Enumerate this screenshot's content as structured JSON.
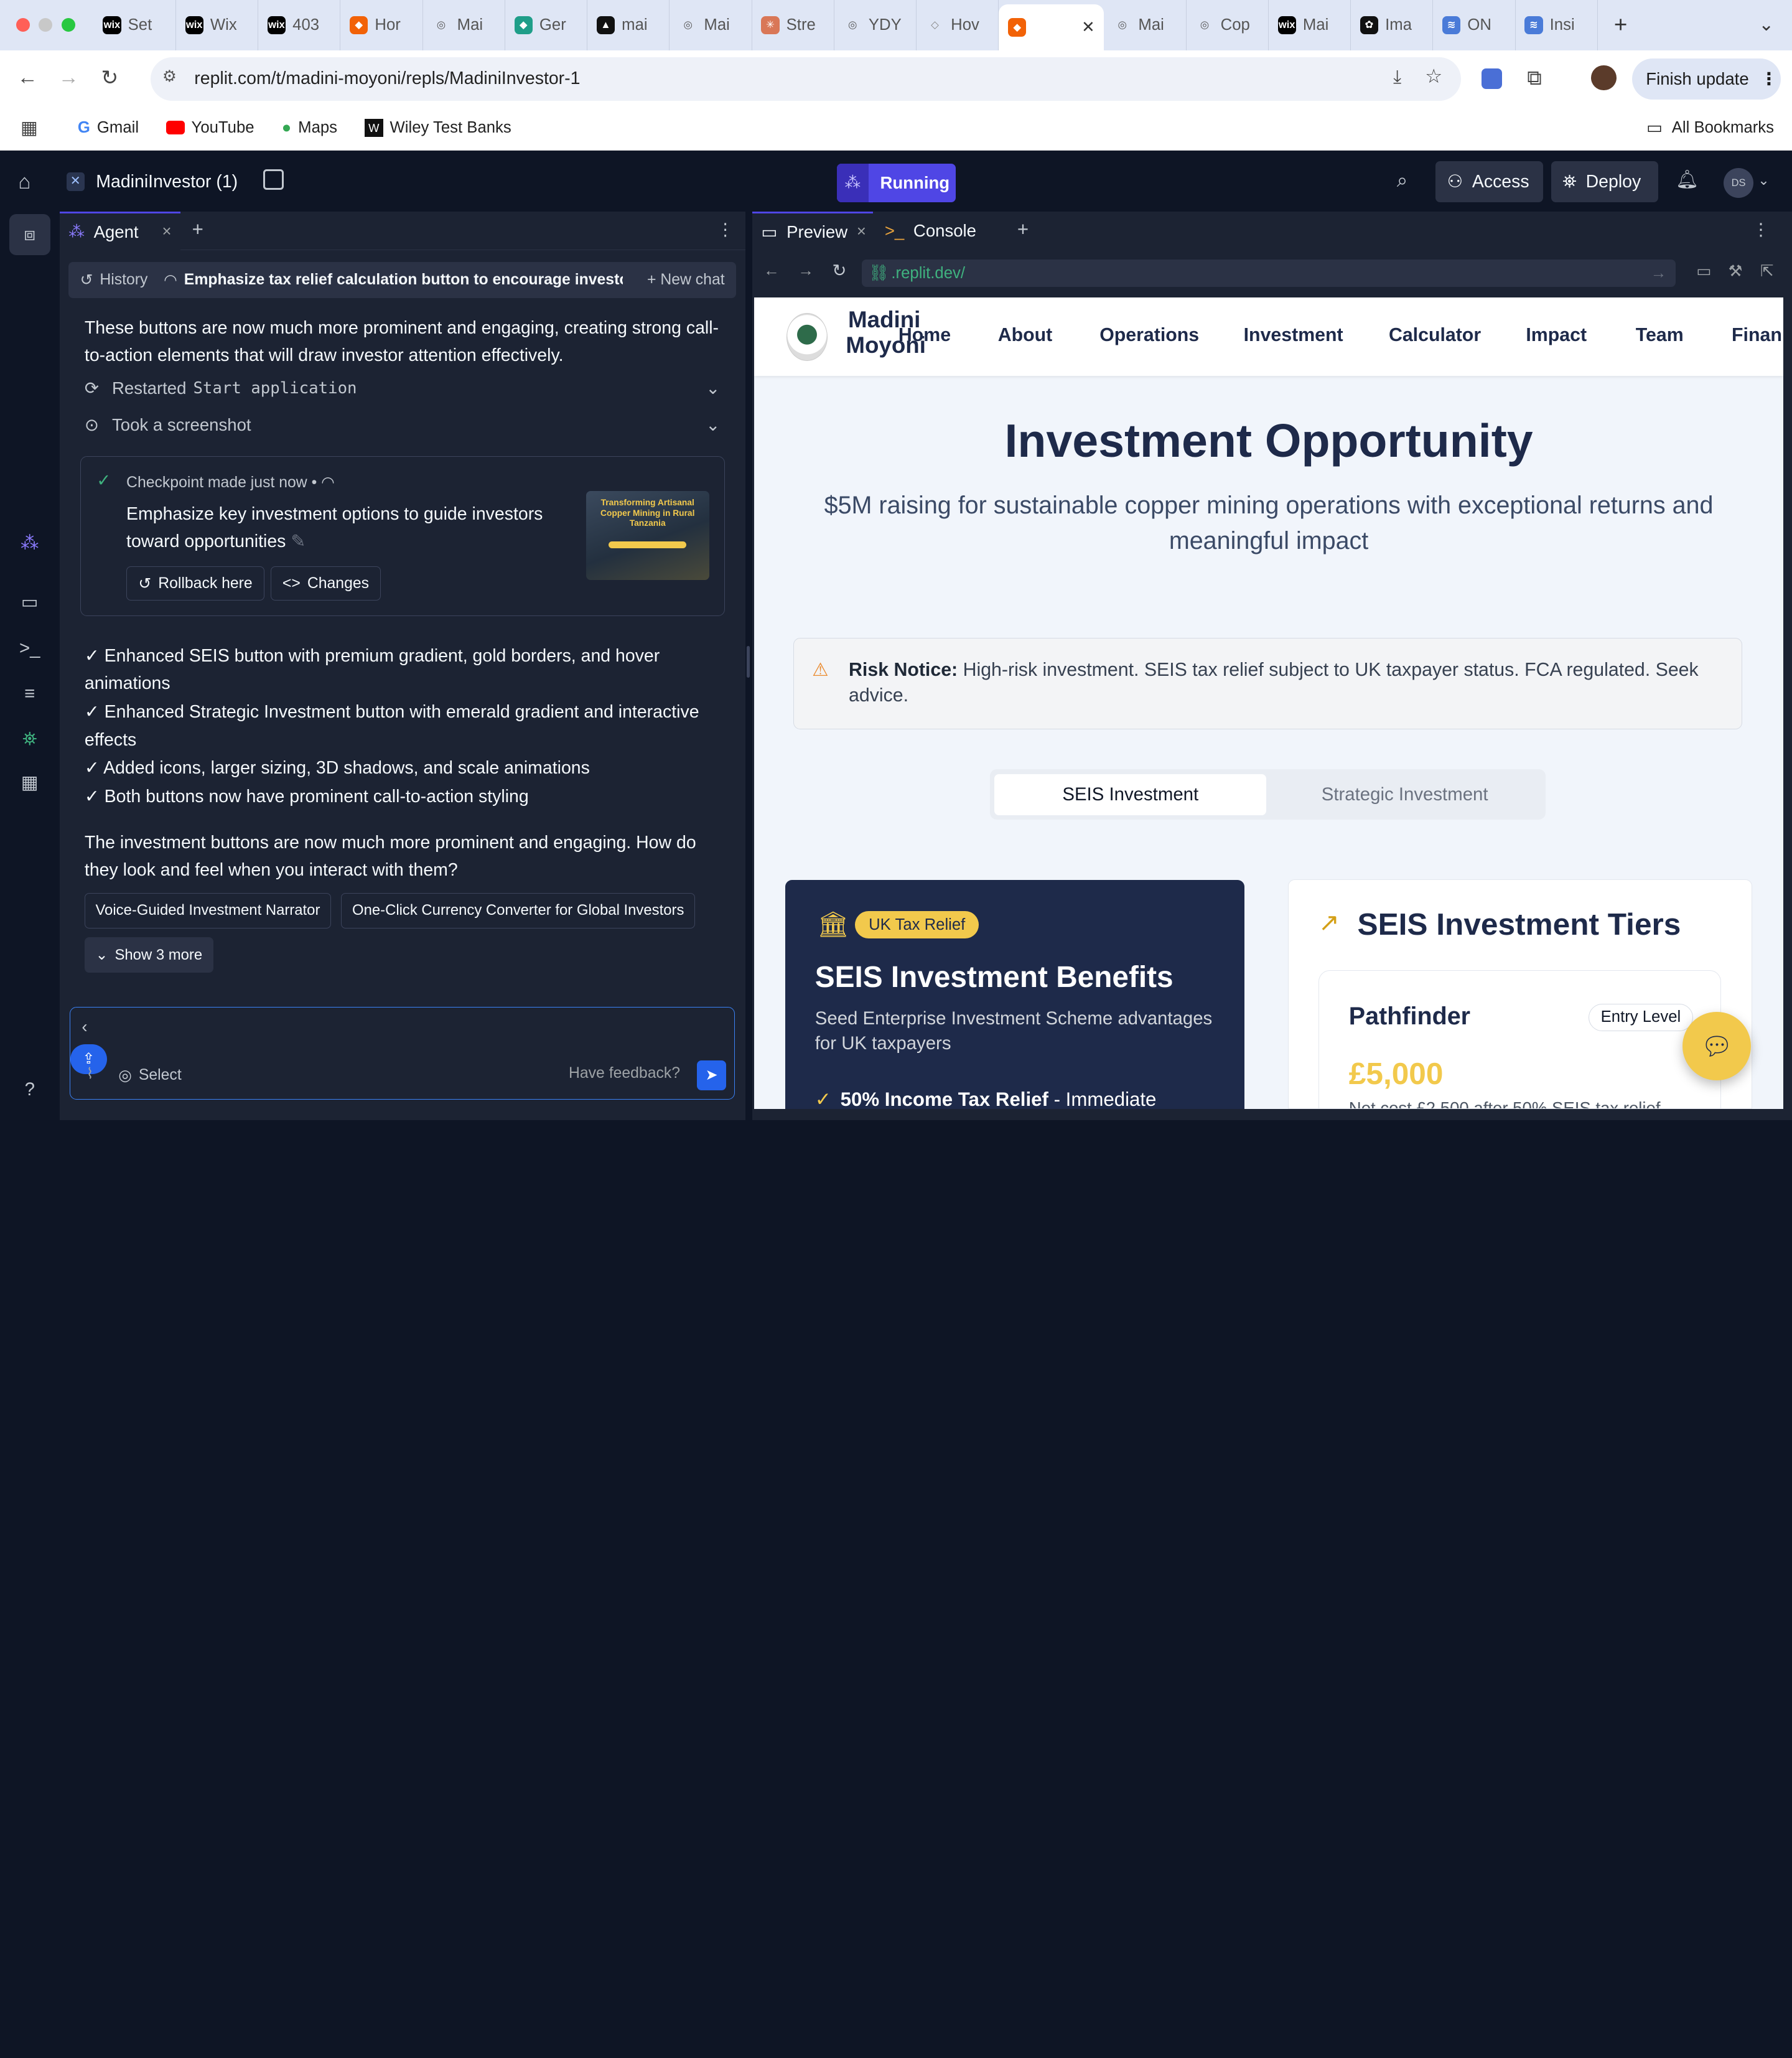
{
  "browser": {
    "tabs": [
      {
        "label": "Set",
        "fav": "wix"
      },
      {
        "label": "Wix",
        "fav": "wix"
      },
      {
        "label": "403",
        "fav": "wix"
      },
      {
        "label": "Hor",
        "fav": "replit"
      },
      {
        "label": "Mai",
        "fav": "globe"
      },
      {
        "label": "Ger",
        "fav": "gem"
      },
      {
        "label": "mai",
        "fav": "tri"
      },
      {
        "label": "Mai",
        "fav": "globe"
      },
      {
        "label": "Stre",
        "fav": "star"
      },
      {
        "label": "YDY",
        "fav": "globe"
      },
      {
        "label": "Hov",
        "fav": "w"
      },
      {
        "label": "",
        "fav": "replit",
        "active": true
      },
      {
        "label": "Mai",
        "fav": "globe"
      },
      {
        "label": "Cop",
        "fav": "globe"
      },
      {
        "label": "Mai",
        "fav": "wix"
      },
      {
        "label": "Ima",
        "fav": "openai"
      },
      {
        "label": "ON",
        "fav": "stack"
      },
      {
        "label": "Insi",
        "fav": "stack"
      }
    ],
    "url": "replit.com/t/madini-moyoni/repls/MadiniInvestor-1",
    "finish_update": "Finish update",
    "bookmarks": [
      "Gmail",
      "YouTube",
      "Maps",
      "Wiley Test Banks"
    ],
    "all_bookmarks": "All Bookmarks"
  },
  "replit": {
    "project": "MadiniInvestor (1)",
    "status": "Running",
    "access": "Access",
    "deploy": "Deploy",
    "avatar": "DS"
  },
  "agent": {
    "tab_label": "Agent",
    "history": "History",
    "thread_title": "Emphasize tax relief calculation button to encourage investor ...",
    "new_chat": "New chat",
    "intro_text": "These buttons are now much more prominent and engaging, creating strong call-to-action elements that will draw investor attention effectively.",
    "restarted_label": "Restarted",
    "restarted_code": "Start application",
    "screenshot_label": "Took a screenshot",
    "checkpoint_meta": "Checkpoint made just now",
    "checkpoint_title": "Emphasize key investment options to guide investors toward opportunities",
    "rollback": "Rollback here",
    "changes": "Changes",
    "thumb_title": "Transforming Artisanal Copper Mining in Rural Tanzania",
    "bullets": [
      "✓ Enhanced SEIS button with premium gradient, gold borders, and hover animations",
      "✓ Enhanced Strategic Investment button with emerald gradient and interactive effects",
      "✓ Added icons, larger sizing, 3D shadows, and scale animations",
      "✓ Both buttons now have prominent call-to-action styling"
    ],
    "question": "The investment buttons are now much more prominent and engaging. How do they look and feel when you interact with them?",
    "suggestions": [
      "Voice-Guided Investment Narrator",
      "One-Click Currency Converter for Global Investors"
    ],
    "show_more": "Show 3 more",
    "input_value": "‹",
    "select": "Select",
    "feedback": "Have feedback?"
  },
  "preview": {
    "tab_preview": "Preview",
    "tab_console": "Console",
    "url": ".replit.dev/"
  },
  "site": {
    "logo_line1": "Madini",
    "logo_line2": "Moyoni",
    "nav": [
      "Home",
      "About",
      "Operations",
      "Investment",
      "Calculator",
      "Impact",
      "Team",
      "Financ"
    ],
    "hero_title": "Investment Opportunity",
    "hero_sub": "$5M raising for sustainable copper mining operations with exceptional returns and meaningful impact",
    "risk_label": "Risk Notice:",
    "risk_text": "High-risk investment. SEIS tax relief subject to UK taxpayer status. FCA regulated. Seek advice.",
    "toggle": [
      "SEIS Investment",
      "Strategic Investment"
    ],
    "benefits_badge": "UK Tax Relief",
    "benefits_title": "SEIS Investment Benefits",
    "benefits_sub": "Seed Enterprise Investment Scheme advantages for UK taxpayers",
    "benefit1_bold": "50% Income Tax Relief",
    "benefit1_rest": " - Immediate",
    "tiers_title": "SEIS Investment Tiers",
    "tier_name": "Pathfinder",
    "tier_badge": "Entry Level",
    "tier_amount": "£5,000",
    "tier_note": "Net cost £2,500 after 50% SEIS tax relief"
  },
  "colors": {
    "replit_bg": "#0e1525",
    "panel_bg": "#1c2333",
    "running": "#4f46e5",
    "site_navy": "#1e2a4a",
    "gold": "#f2c94c"
  }
}
